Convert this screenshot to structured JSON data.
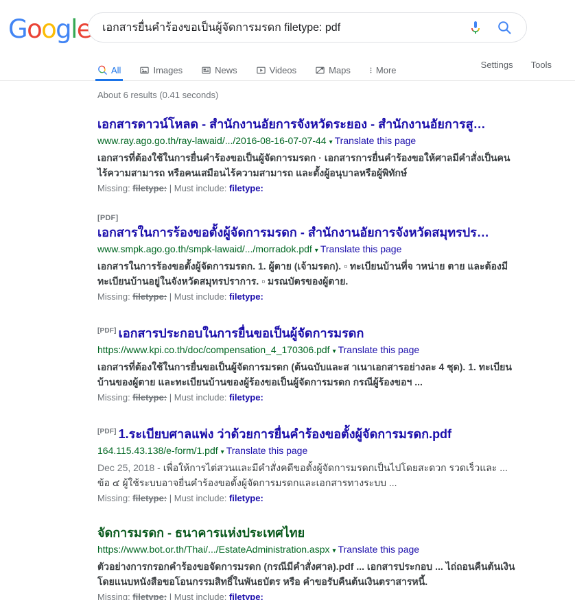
{
  "header": {
    "logo_letters": [
      {
        "ch": "G",
        "color": "#4285F4"
      },
      {
        "ch": "o",
        "color": "#EA4335"
      },
      {
        "ch": "o",
        "color": "#FBBC05"
      },
      {
        "ch": "g",
        "color": "#4285F4"
      },
      {
        "ch": "l",
        "color": "#34A853"
      },
      {
        "ch": "e",
        "color": "#EA4335"
      }
    ],
    "logo_text": "Google",
    "search": {
      "value": "เอกสารยื่นคำร้องขอเป็นผู้จัดการมรดก filetype: pdf",
      "placeholder": "Search",
      "mic_icon": "microphone-icon",
      "search_icon": "search-icon"
    }
  },
  "nav": {
    "tabs": [
      {
        "label": "All",
        "icon": "search-icon",
        "active": true
      },
      {
        "label": "Images",
        "icon": "image-icon",
        "active": false
      },
      {
        "label": "News",
        "icon": "news-icon",
        "active": false
      },
      {
        "label": "Videos",
        "icon": "video-icon",
        "active": false
      },
      {
        "label": "Maps",
        "icon": "map-pin-icon",
        "active": false
      },
      {
        "label": "More",
        "icon": "more-vertical-icon",
        "active": false
      }
    ],
    "right_links": [
      {
        "label": "Settings"
      },
      {
        "label": "Tools"
      }
    ]
  },
  "results_page": {
    "stats": "About 6 results (0.41 seconds)",
    "missing_prefix": "Missing: ",
    "missing_term": "filetype:",
    "must_separator": " | Must include: ",
    "must_term": "filetype:",
    "translate_label": "Translate this page",
    "caret": "▾",
    "pdf_badge": "[PDF]",
    "results": [
      {
        "pdf_badge_mode": "none",
        "title": "เอกสารดาวน์โหลด - สำนักงานอัยการจังหวัดระยอง - สำนักงานอัยการสู…",
        "title_color": "blue",
        "url": "www.ray.ago.go.th/ray-lawaid/.../2016-08-16-07-07-44",
        "snippet_bold": "เอกสารที่ต้องใช้ในการยื่นคำร้องขอเป็นผู้จัดการมรดก · เอกสารการยื่นคำร้องขอให้ศาลมีคำสั่งเป็นคนไร้ความสามารถ หรือคนเสมือนไร้ความสามารถ และตั้งผู้อนุบาลหรือผู้พิทักษ์",
        "snippet_date": "",
        "snippet_plain": ""
      },
      {
        "pdf_badge_mode": "block",
        "title": "เอกสารในการร้องขอตั้งผู้จัดการมรดก - สำนักงานอัยการจังหวัดสมุทรปร…",
        "title_color": "blue",
        "url": "www.smpk.ago.go.th/smpk-lawaid/.../morradok.pdf",
        "snippet_bold": "เอกสารในการร้องขอตั้งผู้จัดการมรดก. 1. ผู้ตาย (เจ้ามรดก). ▫ ทะเบียนบ้านที่จ าหน่าย ตาย และต้องมีทะเบียนบ้านอยู่ในจังหวัดสมุทรปราการ. ▫ มรณบัตรของผู้ตาย.",
        "snippet_date": "",
        "snippet_plain": ""
      },
      {
        "pdf_badge_mode": "inline",
        "title": "เอกสารประกอบในการยื่นขอเป็นผู้จัดการมรดก",
        "title_color": "blue",
        "url": "https://www.kpi.co.th/doc/compensation_4_170306.pdf",
        "snippet_bold": "เอกสารที่ต้องใช้ในการยื่นขอเป็นผู้จัดการมรดก (ต้นฉบับและส าเนาเอกสารอย่างละ 4 ชุด). 1. ทะเบียนบ้านของผู้ตาย และทะเบียนบ้านของผู้ร้องขอเป็นผู้จัดการมรดก กรณีผู้ร้องขอฯ ...",
        "snippet_date": "",
        "snippet_plain": ""
      },
      {
        "pdf_badge_mode": "inline",
        "title": "1.ระเบียบศาลแพ่ง ว่าด้วยการยื่นคำร้องขอตั้งผู้จัดการมรดก.pdf",
        "title_color": "blue",
        "url": "164.115.43.138/e-form/1.pdf",
        "snippet_bold": "",
        "snippet_date": "Dec 25, 2018 - ",
        "snippet_plain": "เพื่อให้การไต่สวนและมีคำสั่งคดีขอตั้งผู้จัดการมรดกเป็นไปโดยสะดวก รวดเร็วและ ... ข้อ ๔ ผู้ใช้ระบบอาจยื่นคำร้องขอตั้งผู้จัดการมรดกและเอกสารทางระบบ ..."
      },
      {
        "pdf_badge_mode": "none",
        "title": "จัดการมรดก - ธนาคารแห่งประเทศไทย",
        "title_color": "green",
        "url": "https://www.bot.or.th/Thai/.../EstateAdministration.aspx",
        "snippet_bold": "ตัวอย่างการกรอกคำร้องขอจัดการมรดก (กรณีมีคำสั่งศาล).pdf ... เอกสารประกอบ ... ไถ่ถอนคืนต้นเงิน โดยแนบหนังสือขอโอนกรรมสิทธิ์ในพันธบัตร หรือ คำขอรับคืนต้นเงินตราสารหนี้.",
        "snippet_date": "",
        "snippet_plain": ""
      }
    ]
  },
  "colors": {
    "link_blue": "#1a0dab",
    "url_green": "#006621",
    "accent_blue": "#1a73e8",
    "muted_gray": "#70757a",
    "body_gray": "#3c4043"
  }
}
